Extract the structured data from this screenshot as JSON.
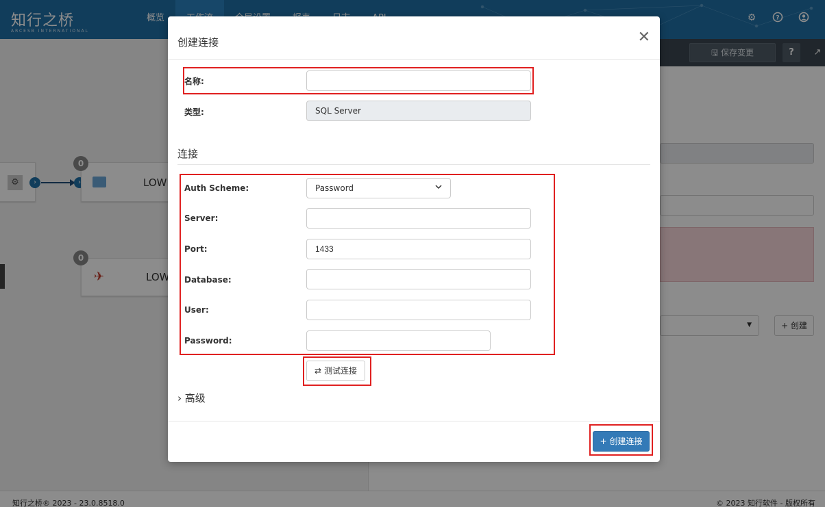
{
  "app": {
    "logo_cn": "知行之桥",
    "logo_en": "ARCESB INTERNATIONAL"
  },
  "nav": {
    "items": [
      {
        "label": "概览"
      },
      {
        "label": "工作流"
      },
      {
        "label": "全局设置"
      },
      {
        "label": "报表"
      },
      {
        "label": "日志"
      },
      {
        "label": "API"
      }
    ]
  },
  "toolbar": {
    "save_label": "保存变更",
    "help_label": "?"
  },
  "canvas": {
    "node1_badge": "0",
    "node1_label": "LOWI",
    "node2_badge": "0",
    "node2_label": "LOW"
  },
  "right_panel": {
    "create_label": "+ 创建"
  },
  "modal": {
    "title": "创建连接",
    "name_label": "名称:",
    "name_value": "",
    "type_label": "类型:",
    "type_value": "SQL Server",
    "section_label": "连接",
    "auth_label": "Auth Scheme:",
    "auth_value": "Password",
    "server_label": "Server:",
    "server_value": "",
    "port_label": "Port:",
    "port_value": "1433",
    "database_label": "Database:",
    "database_value": "",
    "user_label": "User:",
    "user_value": "",
    "password_label": "Password:",
    "password_value": "",
    "test_label": "测试连接",
    "advanced_label": "高级",
    "create_label": "创建连接"
  },
  "footer": {
    "left": "知行之桥® 2023 - 23.0.8518.0",
    "right": "© 2023 知行软件 - 版权所有"
  },
  "colors": {
    "navbar": "#1f6fa6",
    "primary_button": "#337ab7",
    "highlight": "#e02020"
  }
}
